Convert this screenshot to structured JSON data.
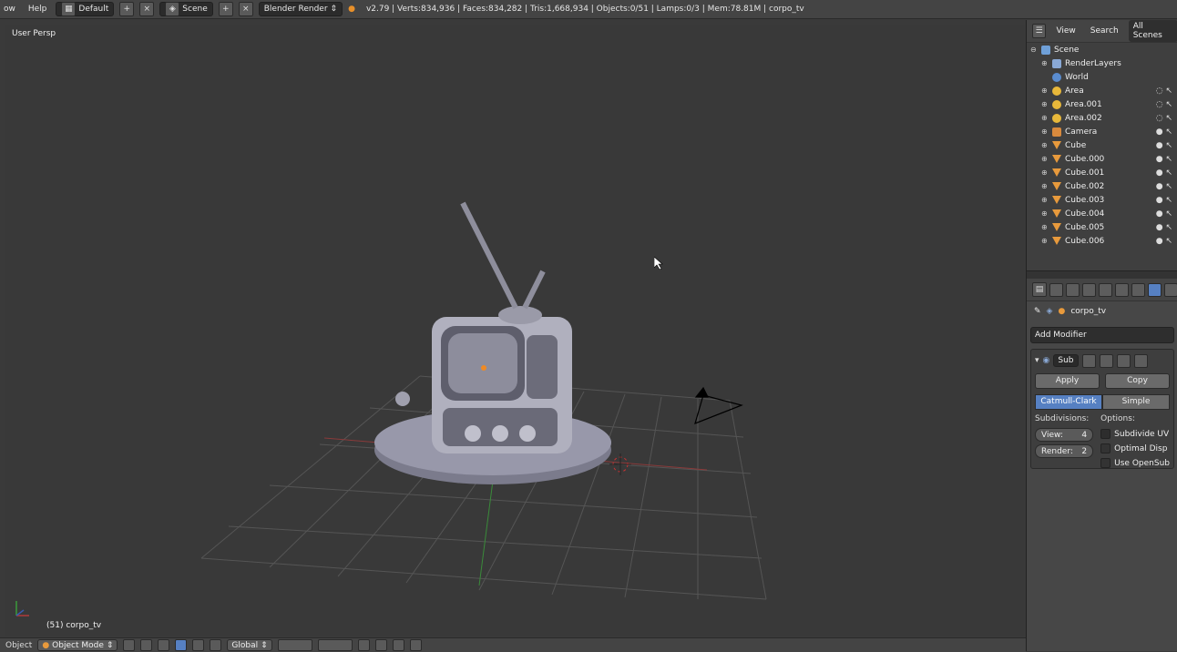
{
  "topbar": {
    "menus": [
      "ow",
      "Help"
    ],
    "layout": "Default",
    "scene": "Scene",
    "engine": "Blender Render",
    "stats": "v2.79 | Verts:834,936 | Faces:834,282 | Tris:1,668,934 | Objects:0/51 | Lamps:0/3 | Mem:78.81M | corpo_tv"
  },
  "viewport": {
    "view_label": "User Persp",
    "object_label": "(51) corpo_tv"
  },
  "outliner": {
    "tabs": [
      "View",
      "Search",
      "All Scenes"
    ],
    "items": [
      {
        "name": "Scene",
        "icon": "scene-icon"
      },
      {
        "name": "RenderLayers",
        "icon": "renderlayers-icon"
      },
      {
        "name": "World",
        "icon": "world-icon"
      },
      {
        "name": "Area",
        "icon": "lamp-icon"
      },
      {
        "name": "Area.001",
        "icon": "lamp-icon"
      },
      {
        "name": "Area.002",
        "icon": "lamp-icon"
      },
      {
        "name": "Camera",
        "icon": "camera-icon"
      },
      {
        "name": "Cube",
        "icon": "mesh-icon"
      },
      {
        "name": "Cube.000",
        "icon": "mesh-icon"
      },
      {
        "name": "Cube.001",
        "icon": "mesh-icon"
      },
      {
        "name": "Cube.002",
        "icon": "mesh-icon"
      },
      {
        "name": "Cube.003",
        "icon": "mesh-icon"
      },
      {
        "name": "Cube.004",
        "icon": "mesh-icon"
      },
      {
        "name": "Cube.005",
        "icon": "mesh-icon"
      },
      {
        "name": "Cube.006",
        "icon": "mesh-icon"
      }
    ]
  },
  "properties": {
    "object_name": "corpo_tv",
    "add_modifier": "Add Modifier",
    "modifier": {
      "name": "Sub",
      "apply": "Apply",
      "copy": "Copy",
      "mode_a": "Catmull-Clark",
      "mode_b": "Simple",
      "subdivisions_label": "Subdivisions:",
      "options_label": "Options:",
      "view_label": "View:",
      "view_value": "4",
      "render_label": "Render:",
      "render_value": "2",
      "opt1": "Subdivide UV",
      "opt2": "Optimal Disp",
      "opt3": "Use OpenSub"
    }
  },
  "bottombar": {
    "menu": "Object",
    "mode": "Object Mode",
    "orientation": "Global"
  },
  "colors": {
    "accent": "#5680c2",
    "grid": "#555555",
    "axis_x": "#8a3a3a",
    "axis_y": "#3a8a3a"
  }
}
